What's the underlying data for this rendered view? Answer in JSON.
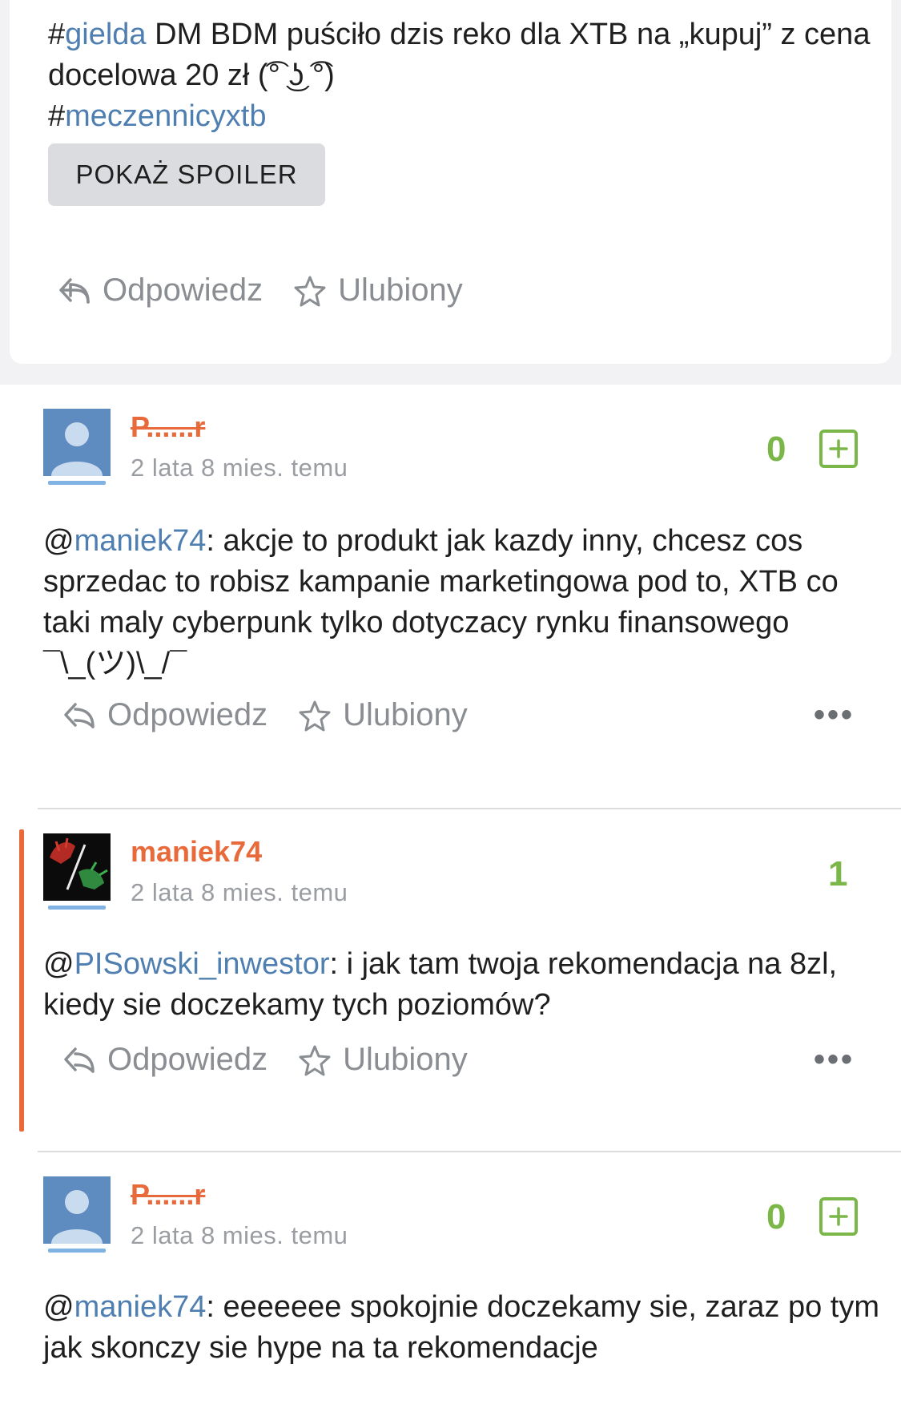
{
  "top_post": {
    "text_part1": "#",
    "tag1": "gielda",
    "text_part2": " DM BDM puściło dzis reko dla XTB na „kupuj” z cena docelowa 20 zł (͡° ͜ʖ ͡°)",
    "text_part3": "#",
    "tag2": "meczennicyxtb",
    "spoiler_label": "POKAŻ SPOILER",
    "reply_label": "Odpowiedz",
    "favorite_label": "Ulubiony"
  },
  "comments": [
    {
      "username": "P......r",
      "timestamp": "2 lata 8 mies. temu",
      "score": "0",
      "mention": "maniek74",
      "text": ": akcje to produkt jak kazdy inny, chcesz cos sprzedac to robisz kampanie marketingowa pod to, XTB co taki maly cyberpunk tylko dotyczacy rynku finansowego ¯\\_(ツ)\\_/¯",
      "at": "@",
      "reply_label": "Odpowiedz",
      "favorite_label": "Ulubiony",
      "more_label": "•••"
    },
    {
      "username": "maniek74",
      "timestamp": "2 lata 8 mies. temu",
      "score": "1",
      "mention": "PISowski_inwestor",
      "text": ": i jak tam twoja rekomendacja na 8zl, kiedy sie doczekamy tych poziomów?",
      "at": "@",
      "reply_label": "Odpowiedz",
      "favorite_label": "Ulubiony",
      "more_label": "•••"
    },
    {
      "username": "P......r",
      "timestamp": "2 lata 8 mies. temu",
      "score": "0",
      "mention": "maniek74",
      "text": ": eeeeeee spokojnie doczekamy sie, zaraz po tym jak skonczy sie hype na ta rekomendacje",
      "at": "@"
    }
  ],
  "colors": {
    "accent_orange": "#e8693a",
    "link_blue": "#4f7fb1",
    "score_green": "#7ab648",
    "muted_gray": "#8a8d91"
  },
  "icons": [
    "reply-icon",
    "star-icon",
    "plus-icon",
    "more-icon",
    "avatar-icon"
  ]
}
